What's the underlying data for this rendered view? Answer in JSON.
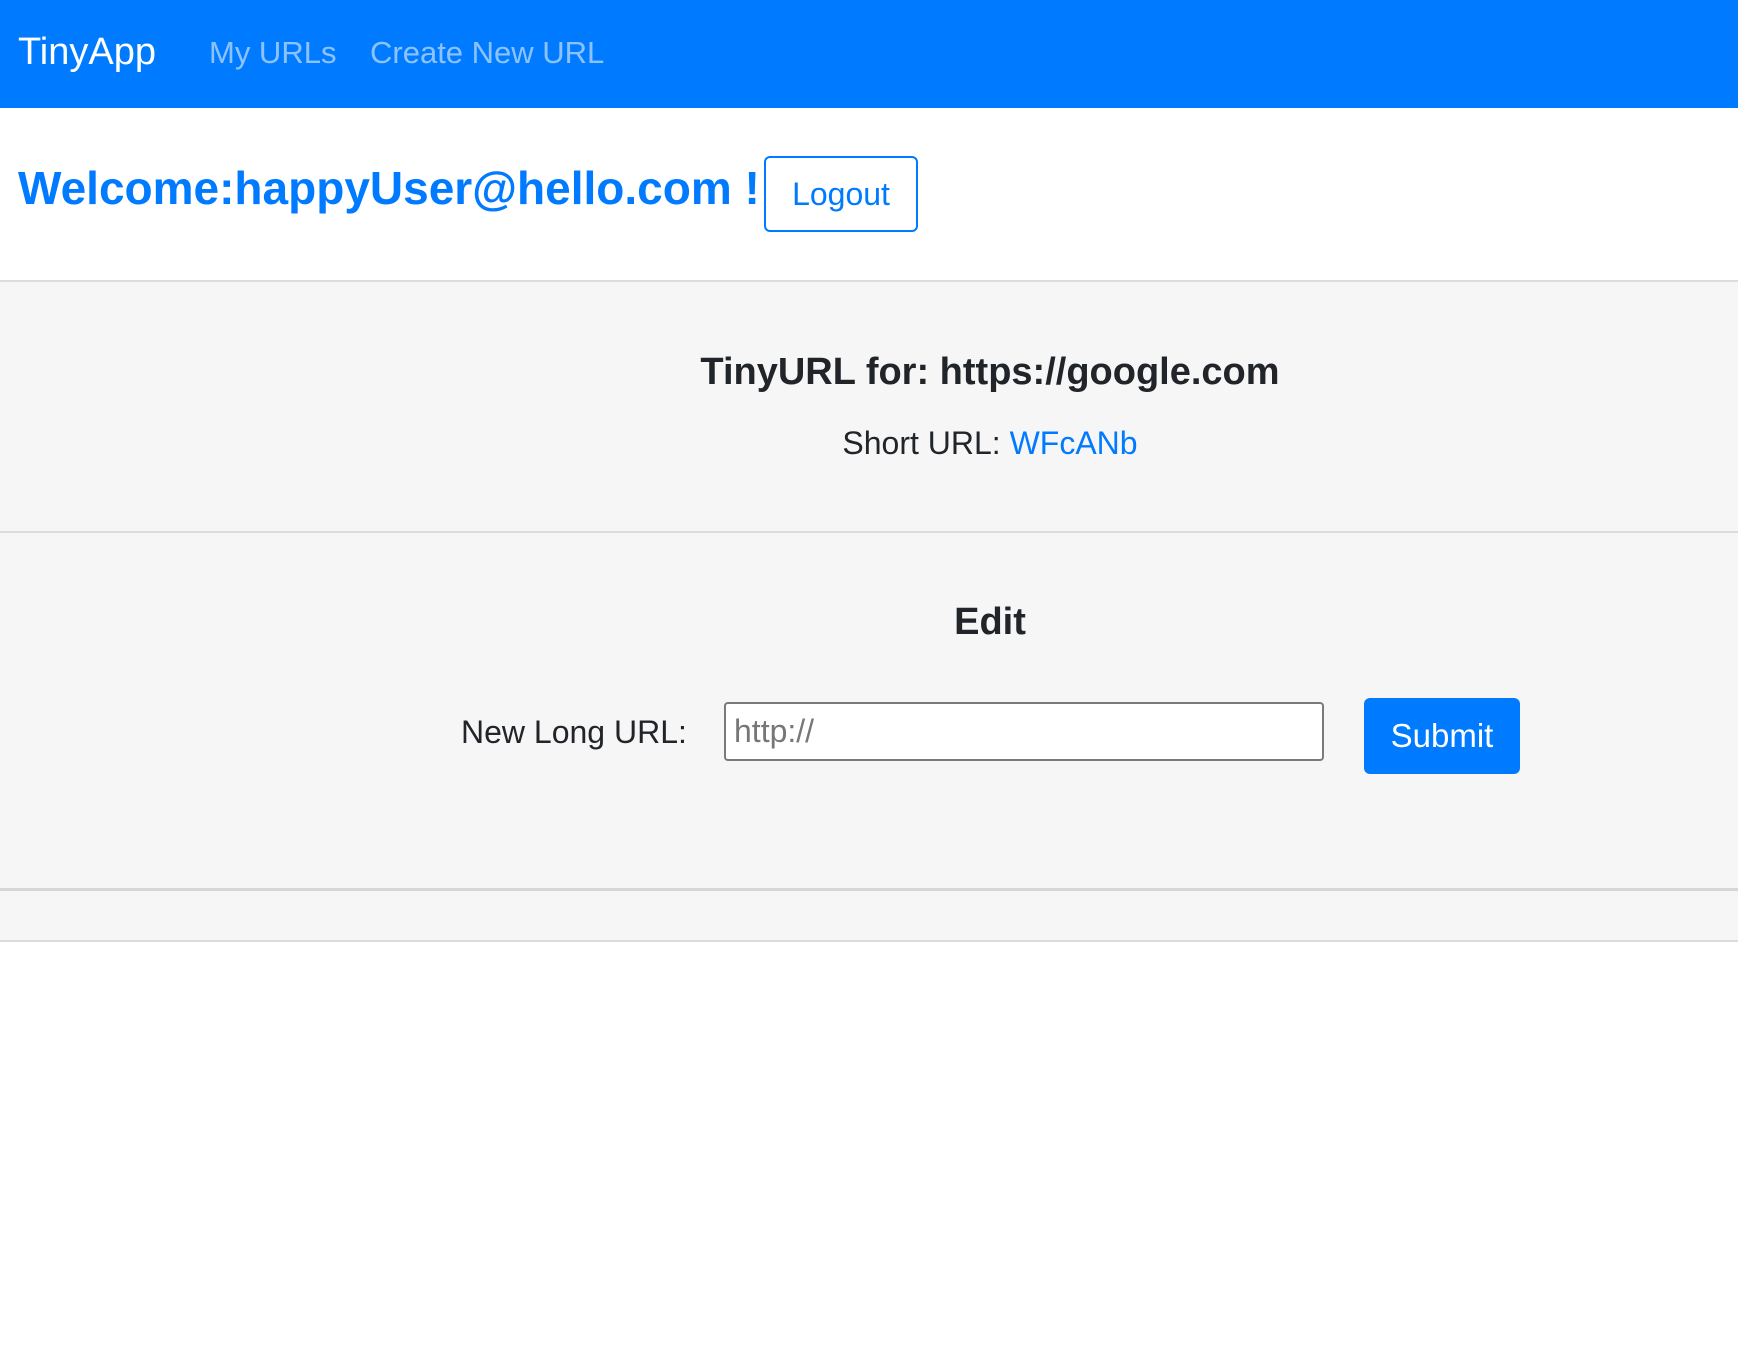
{
  "navbar": {
    "brand": "TinyApp",
    "links": [
      "My URLs",
      "Create New URL"
    ],
    "background": "#007bff"
  },
  "header": {
    "welcome_text": "Welcome:happyUser@hello.com !",
    "logout_label": "Logout"
  },
  "url_card": {
    "title": "TinyURL for: https://google.com",
    "short_url_label": "Short URL: ",
    "short_url_value": "WFcANb"
  },
  "edit": {
    "title": "Edit",
    "field_label": "New Long URL:",
    "field_placeholder": "http://",
    "field_value": "",
    "submit_label": "Submit"
  },
  "colors": {
    "accent": "#007bff",
    "card_bg": "#f6f6f6"
  }
}
